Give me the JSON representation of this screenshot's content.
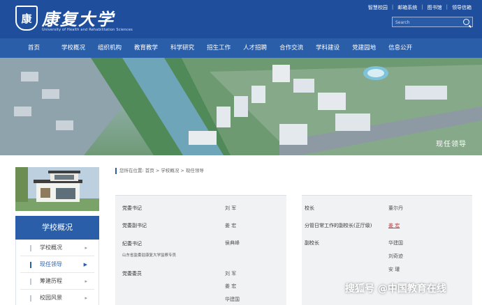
{
  "header": {
    "logo_badge": "康",
    "logo_text": "康复大学",
    "logo_sub": "University of Health and Rehabilitation Sciences",
    "top_links": [
      "智慧校园",
      "邮箱系统",
      "图书馆",
      "领导信箱"
    ],
    "search_placeholder": "Search"
  },
  "nav": [
    "首页",
    "学校概况",
    "组织机构",
    "教育教学",
    "科学研究",
    "招生工作",
    "人才招聘",
    "合作交流",
    "学科建设",
    "党建园地",
    "信息公开"
  ],
  "banner": {
    "caption": "现任领导"
  },
  "sidebar": {
    "title": "学校概况",
    "items": [
      {
        "label": "学校概况",
        "active": false
      },
      {
        "label": "现任领导",
        "active": true
      },
      {
        "label": "筹建历程",
        "active": false
      },
      {
        "label": "校园风景",
        "active": false
      }
    ]
  },
  "breadcrumb": "您所在位置: 首页 > 学校概况 > 现任领导",
  "left_panel": {
    "rows": [
      {
        "title": "党委书记",
        "names": [
          "刘  军"
        ]
      },
      {
        "title": "党委副书记",
        "names": [
          "姜  宏"
        ]
      },
      {
        "title": "纪委书记",
        "names": [
          "侯典峰"
        ],
        "note": "山东省监委驻康复大学监察专员"
      },
      {
        "title": "党委委员",
        "names": [
          "刘  军",
          "姜  宏",
          "华建国"
        ]
      }
    ]
  },
  "right_panel": {
    "rows": [
      {
        "title": "校长",
        "names": [
          "董尔丹"
        ]
      },
      {
        "title": "分管日常工作的副校长(正厅级)",
        "names": [
          "姜  宏"
        ]
      },
      {
        "title": "副校长",
        "names": [
          "华建国",
          "刘奇迹",
          "安  瓘"
        ]
      }
    ]
  },
  "watermark": "搜狐号 @中国教育在线"
}
